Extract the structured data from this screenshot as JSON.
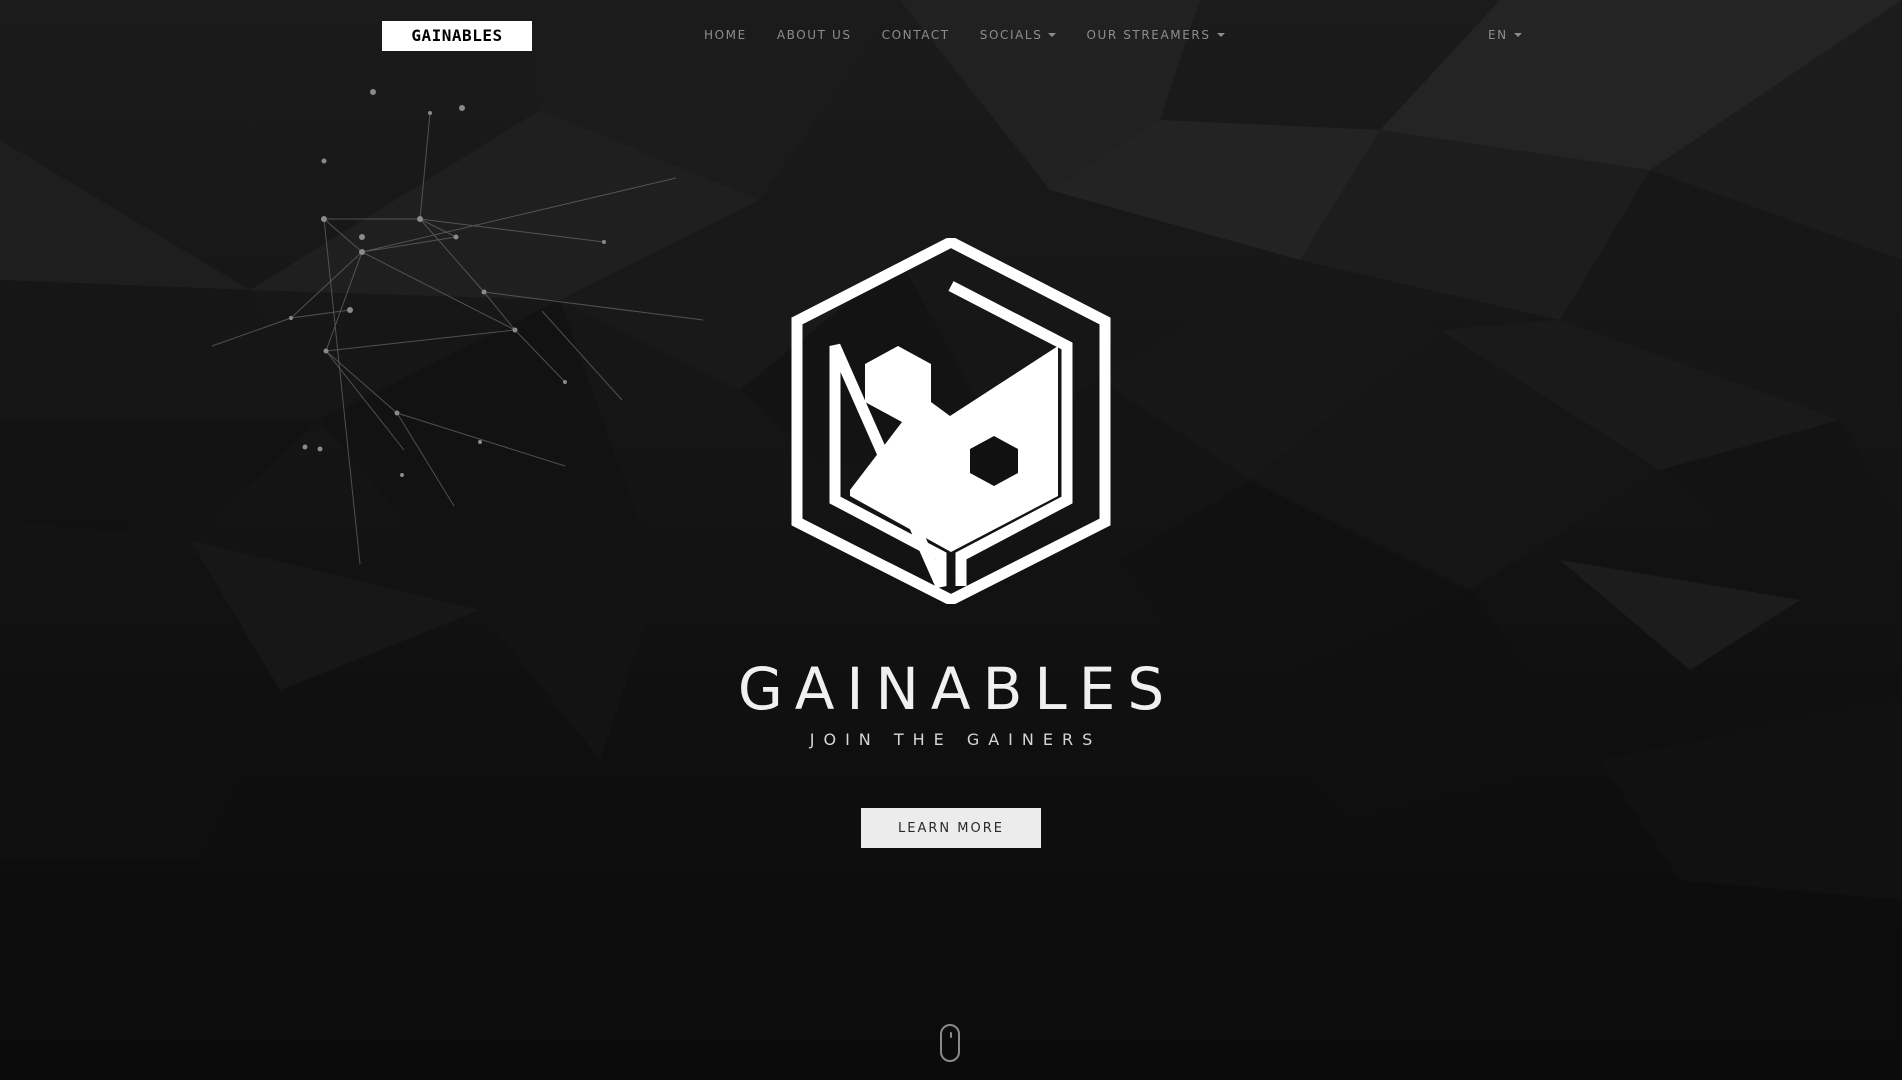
{
  "nav": {
    "brand": "GAINABLES",
    "items": [
      {
        "label": "HOME",
        "dropdown": false
      },
      {
        "label": "ABOUT US",
        "dropdown": false
      },
      {
        "label": "CONTACT",
        "dropdown": false
      },
      {
        "label": "SOCIALS",
        "dropdown": true
      },
      {
        "label": "OUR STREAMERS",
        "dropdown": true
      }
    ],
    "language": "EN"
  },
  "hero": {
    "title": "GAINABLES",
    "subtitle": "JOIN THE GAINERS",
    "cta_label": "LEARN MORE",
    "logo_icon": "gainables-hexagon-logo",
    "scroll_icon": "mouse-scroll-icon"
  },
  "colors": {
    "background": "#0d0d0d",
    "brand_bg": "#ffffff",
    "nav_text": "#8d8d8d",
    "title_text": "#f0f0f0",
    "button_bg": "#ececec"
  }
}
